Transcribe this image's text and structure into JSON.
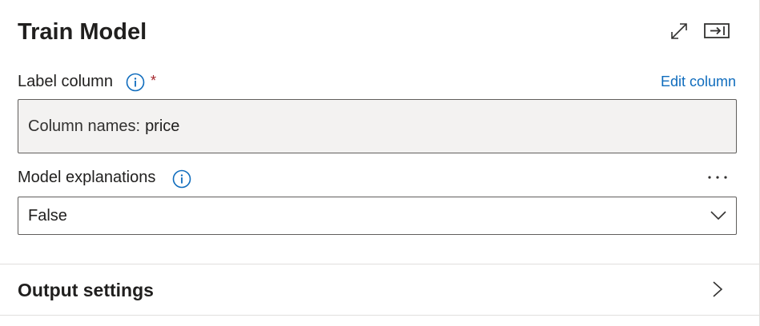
{
  "panel": {
    "title": "Train Model"
  },
  "label_column": {
    "label": "Label column",
    "required_marker": "*",
    "edit_link": "Edit column",
    "prefix": "Column names:",
    "value": "price"
  },
  "model_explanations": {
    "label": "Model explanations",
    "more_label": "···",
    "selected": "False"
  },
  "output_settings": {
    "label": "Output settings"
  },
  "colors": {
    "link": "#0f6cbd",
    "required": "#a4262c",
    "readonly_bg": "#f3f2f1"
  },
  "icons": [
    "expand-icon",
    "collapse-panel-icon",
    "info-icon",
    "more-icon",
    "chevron-down-icon",
    "chevron-right-icon"
  ]
}
